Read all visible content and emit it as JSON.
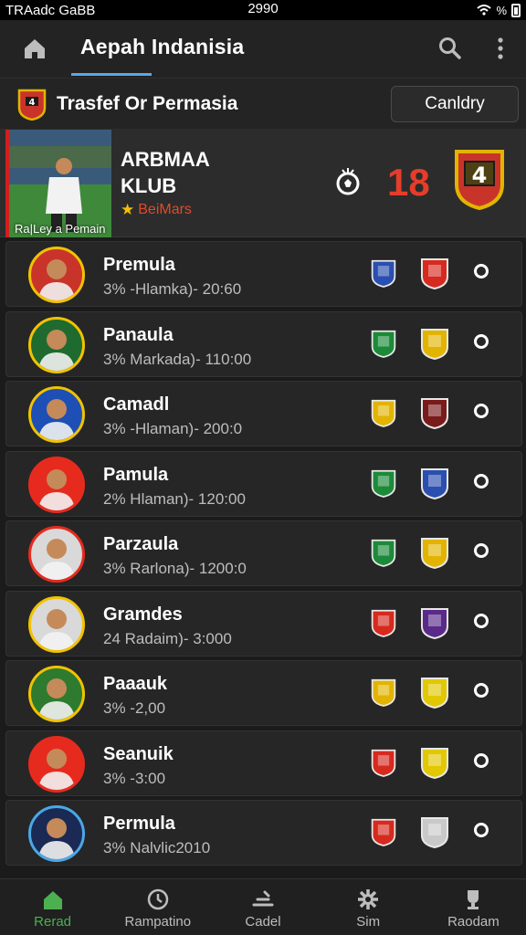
{
  "status_bar": {
    "left_text": "TRAadc GaBB",
    "time": "2990",
    "signal_text": "%"
  },
  "app_bar": {
    "title": "Aepah Indanisia",
    "icons": [
      "home-icon",
      "search-icon",
      "more-vert-icon"
    ]
  },
  "section": {
    "title": "Trasfef Or Permasia",
    "category_button": "Canldry"
  },
  "featured": {
    "caption": "Ra|Ley a Pemain",
    "name_line1": "ARBMAA",
    "name_line2": "KLUB",
    "subtitle": "BeiMars",
    "score": "18"
  },
  "players": [
    {
      "name": "Premula",
      "detail": "3% -Hlamka)- 20:60",
      "ring": "#f2c200",
      "bg": "#c9342a",
      "crests": [
        "#2a4fb0",
        "#d62a1f"
      ]
    },
    {
      "name": "Panaula",
      "detail": "3% Markada)- 110:00",
      "ring": "#f2c200",
      "bg": "#1f6a2e",
      "crests": [
        "#1d8a3a",
        "#e2b400"
      ]
    },
    {
      "name": "Camadl",
      "detail": "3% -Hlaman)- 200:0",
      "ring": "#f2c200",
      "bg": "#1d4fb5",
      "crests": [
        "#e2b400",
        "#7a1b1b"
      ]
    },
    {
      "name": "Pamula",
      "detail": "2% Hlaman)- 120:00",
      "ring": "#e62b1e",
      "bg": "#e62b1e",
      "crests": [
        "#1d8a3a",
        "#2a4fb0"
      ]
    },
    {
      "name": "Parzaula",
      "detail": "3% Rarlona)- 1200:0",
      "ring": "#e62b1e",
      "bg": "#d9d9d9",
      "crests": [
        "#1d8a3a",
        "#e2b400"
      ]
    },
    {
      "name": "Gramdes",
      "detail": "24 Radaim)- 3:000",
      "ring": "#f2c200",
      "bg": "#d9d9d9",
      "crests": [
        "#d62a1f",
        "#5a2a8a"
      ]
    },
    {
      "name": "Paaauk",
      "detail": "3% -2,00",
      "ring": "#f2c200",
      "bg": "#2e7a2e",
      "crests": [
        "#e2b400",
        "#e2c800"
      ]
    },
    {
      "name": "Seanuik",
      "detail": "3% -3:00",
      "ring": "#e62b1e",
      "bg": "#e62b1e",
      "crests": [
        "#d62a1f",
        "#e2c800"
      ]
    },
    {
      "name": "Permula",
      "detail": "3% Nalvlic2010",
      "ring": "#4aa8e6",
      "bg": "#1a2a55",
      "crests": [
        "#d62a1f",
        "#c9c9c9"
      ]
    }
  ],
  "bottom_nav": [
    {
      "label": "Rerad",
      "icon": "home-icon",
      "active": true
    },
    {
      "label": "Rampatino",
      "icon": "clock-icon",
      "active": false
    },
    {
      "label": "Cadel",
      "icon": "transfer-icon",
      "active": false
    },
    {
      "label": "Sim",
      "icon": "gear-icon",
      "active": false
    },
    {
      "label": "Raodam",
      "icon": "trophy-icon",
      "active": false
    }
  ],
  "colors": {
    "accent": "#5aa8e6",
    "active_nav": "#4cb050",
    "score": "#e53d2a",
    "background": "#1b1b1b"
  }
}
